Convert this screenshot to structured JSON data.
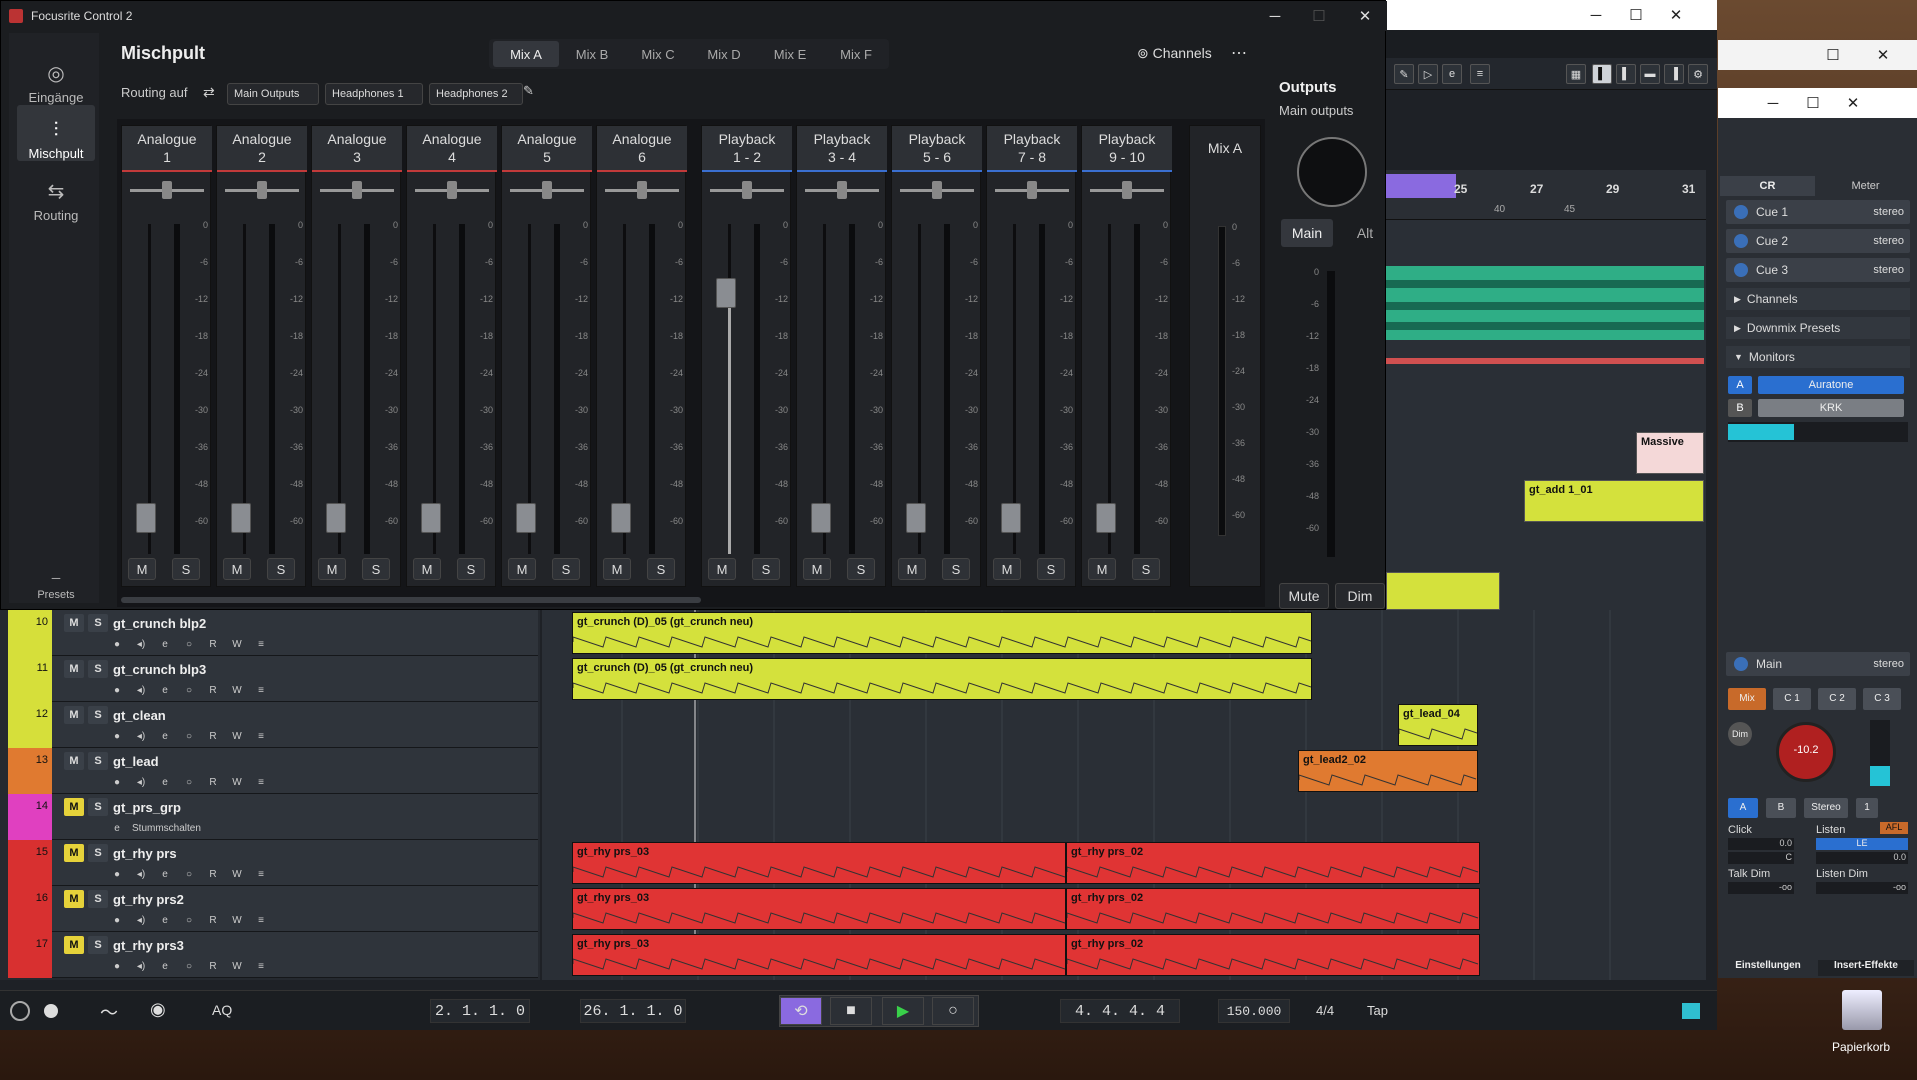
{
  "focusrite": {
    "app_title": "Focusrite Control 2",
    "nav": [
      {
        "label": "Eingänge"
      },
      {
        "label": "Mischpult"
      },
      {
        "label": "Routing"
      }
    ],
    "presets_label": "Presets",
    "mixer_title": "Mischpult",
    "mix_tabs": [
      "Mix A",
      "Mix B",
      "Mix C",
      "Mix D",
      "Mix E",
      "Mix F"
    ],
    "channels_label": "Channels",
    "routing_label": "Routing auf",
    "routing_chips": [
      "Main Outputs",
      "Headphones 1",
      "Headphones 2"
    ],
    "strips": [
      {
        "name": "Analogue",
        "sub": "1",
        "group": "analogue"
      },
      {
        "name": "Analogue",
        "sub": "2",
        "group": "analogue"
      },
      {
        "name": "Analogue",
        "sub": "3",
        "group": "analogue"
      },
      {
        "name": "Analogue",
        "sub": "4",
        "group": "analogue"
      },
      {
        "name": "Analogue",
        "sub": "5",
        "group": "analogue"
      },
      {
        "name": "Analogue",
        "sub": "6",
        "group": "analogue"
      },
      {
        "name": "Playback",
        "sub": "1 - 2",
        "group": "playback"
      },
      {
        "name": "Playback",
        "sub": "3 - 4",
        "group": "playback"
      },
      {
        "name": "Playback",
        "sub": "5 - 6",
        "group": "playback"
      },
      {
        "name": "Playback",
        "sub": "7 - 8",
        "group": "playback"
      },
      {
        "name": "Playback",
        "sub": "9 - 10",
        "group": "playback"
      }
    ],
    "meter_scale": [
      "0",
      "-6",
      "-12",
      "-18",
      "-24",
      "-30",
      "-36",
      "-48",
      "-60"
    ],
    "mute_label": "M",
    "solo_label": "S",
    "mix_a_label": "Mix A",
    "mix_a_scale": [
      "0",
      "-6",
      "-12",
      "-18",
      "-24",
      "-30",
      "-36",
      "-48",
      "-60"
    ],
    "outputs": {
      "title": "Outputs",
      "subtitle": "Main outputs",
      "main": "Main",
      "alt": "Alt",
      "mute": "Mute",
      "dim": "Dim",
      "scale": [
        "0",
        "-6",
        "-12",
        "-18",
        "-24",
        "-30",
        "-36",
        "-48",
        "-60"
      ]
    },
    "colors": {
      "analogue": "#c23a3a",
      "playback": "#3a6fd0"
    }
  },
  "cubase": {
    "ruler_nums": [
      "25",
      "27",
      "29",
      "31"
    ],
    "ruler_sub": [
      "40",
      "45"
    ],
    "upper_clips": [
      {
        "label": "Massive"
      },
      {
        "label": "gt_add 1_01"
      }
    ],
    "tracks": [
      {
        "num": "10",
        "name": "gt_crunch blp2",
        "color": "#d6df3a",
        "m": false,
        "s": false
      },
      {
        "num": "11",
        "name": "gt_crunch blp3",
        "color": "#d6df3a",
        "m": false,
        "s": false
      },
      {
        "num": "12",
        "name": "gt_clean",
        "color": "#d6df3a",
        "m": false,
        "s": false
      },
      {
        "num": "13",
        "name": "gt_lead",
        "color": "#e07a30",
        "m": false,
        "s": false
      },
      {
        "num": "14",
        "name": "gt_prs_grp",
        "color": "#e040c0",
        "m": true,
        "s": false,
        "sub": "Stummschalten"
      },
      {
        "num": "15",
        "name": "gt_rhy prs",
        "color": "#d83030",
        "m": true,
        "s": false
      },
      {
        "num": "16",
        "name": "gt_rhy prs2",
        "color": "#d83030",
        "m": true,
        "s": false
      },
      {
        "num": "17",
        "name": "gt_rhy prs3",
        "color": "#d83030",
        "m": true,
        "s": false
      }
    ],
    "track_btns": {
      "m": "M",
      "s": "S",
      "r": "R",
      "w": "W"
    },
    "clips": [
      {
        "label": "gt_crunch (D)_05 (gt_crunch neu)",
        "color": "#d4e13c"
      },
      {
        "label": "gt_crunch (D)_05 (gt_crunch neu)",
        "color": "#d4e13c"
      },
      {
        "label": "gt_lead_04",
        "color": "#d4e13c"
      },
      {
        "label": "gt_lead2_02",
        "color": "#e07a30"
      },
      {
        "label": "gt_rhy prs_03",
        "color": "#e03434"
      },
      {
        "label": "gt_rhy prs_02",
        "color": "#e03434"
      },
      {
        "label": "gt_rhy prs_03",
        "color": "#e03434"
      },
      {
        "label": "gt_rhy prs_02",
        "color": "#e03434"
      },
      {
        "label": "gt_rhy prs_03",
        "color": "#e03434"
      },
      {
        "label": "gt_rhy prs_02",
        "color": "#e03434"
      }
    ],
    "transport": {
      "aq": "AQ",
      "left_locator": "2. 1. 1. 0",
      "right_locator": "26. 1. 1. 0",
      "position": "4. 4. 4. 4",
      "tempo": "150.000",
      "signature": "4/4",
      "tap": "Tap"
    }
  },
  "controlroom": {
    "tabs": [
      "CR",
      "Meter"
    ],
    "cues": [
      {
        "label": "Cue 1",
        "type": "stereo"
      },
      {
        "label": "Cue 2",
        "type": "stereo"
      },
      {
        "label": "Cue 3",
        "type": "stereo"
      }
    ],
    "sections": [
      "Channels",
      "Downmix Presets",
      "Monitors"
    ],
    "monitors": [
      {
        "key": "A",
        "name": "Auratone"
      },
      {
        "key": "B",
        "name": "KRK"
      }
    ],
    "main": {
      "label": "Main",
      "type": "stereo"
    },
    "source_btns": [
      "Mix",
      "C 1",
      "C 2",
      "C 3"
    ],
    "dim_label": "Dim",
    "level": "-10.2",
    "speaker_btns": [
      "A",
      "B",
      "Stereo",
      "1"
    ],
    "click_label": "Click",
    "click_val": "0.0",
    "click_c": "C",
    "listen_label": "Listen",
    "listen_afl": "AFL",
    "listen_le": "LE",
    "listen_val": "0.0",
    "talkdim_label": "Talk Dim",
    "talkdim_val": "-oo",
    "listendim_label": "Listen Dim",
    "listendim_val": "-oo",
    "bottom_tabs": [
      "Einstellungen",
      "Insert-Effekte"
    ]
  },
  "desktop": {
    "recycle_label": "Papierkorb"
  }
}
